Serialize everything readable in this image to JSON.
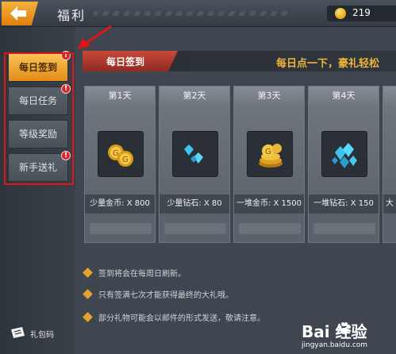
{
  "header": {
    "title": "福利",
    "coins": "219"
  },
  "sidebar": {
    "tabs": [
      {
        "label": "每日签到",
        "active": true,
        "badge": "!"
      },
      {
        "label": "每日任务",
        "active": false,
        "badge": "!"
      },
      {
        "label": "等级奖励",
        "active": false,
        "badge": ""
      },
      {
        "label": "新手送礼",
        "active": false,
        "badge": "!"
      }
    ],
    "gift_code_label": "礼包码"
  },
  "banner": {
    "tag": "每日签到",
    "slogan": "每日点一下，豪礼轻松"
  },
  "cards": [
    {
      "day": "第1天",
      "reward": "少量金币: X 800",
      "icon": "coins-icon"
    },
    {
      "day": "第2天",
      "reward": "少量钻石: X 80",
      "icon": "diamonds-icon"
    },
    {
      "day": "第3天",
      "reward": "一堆金币: X 1500",
      "icon": "coin-pile-icon"
    },
    {
      "day": "第4天",
      "reward": "一堆钻石: X 150",
      "icon": "diamond-pile-icon"
    },
    {
      "day": "",
      "reward": "大",
      "icon": ""
    }
  ],
  "notes": [
    "签到将会在每周日刷新。",
    "只有签满七次才能获得最终的大礼哦。",
    "部分礼物可能会以邮件的形式发送，敬请注意。"
  ],
  "watermark": {
    "brand": "Bai  经验",
    "url": "jingyan.baidu.com"
  },
  "colors": {
    "accent": "#e48c17",
    "banner_red": "#c9483a",
    "badge_red": "#d8262a",
    "highlight": "#e01515"
  }
}
